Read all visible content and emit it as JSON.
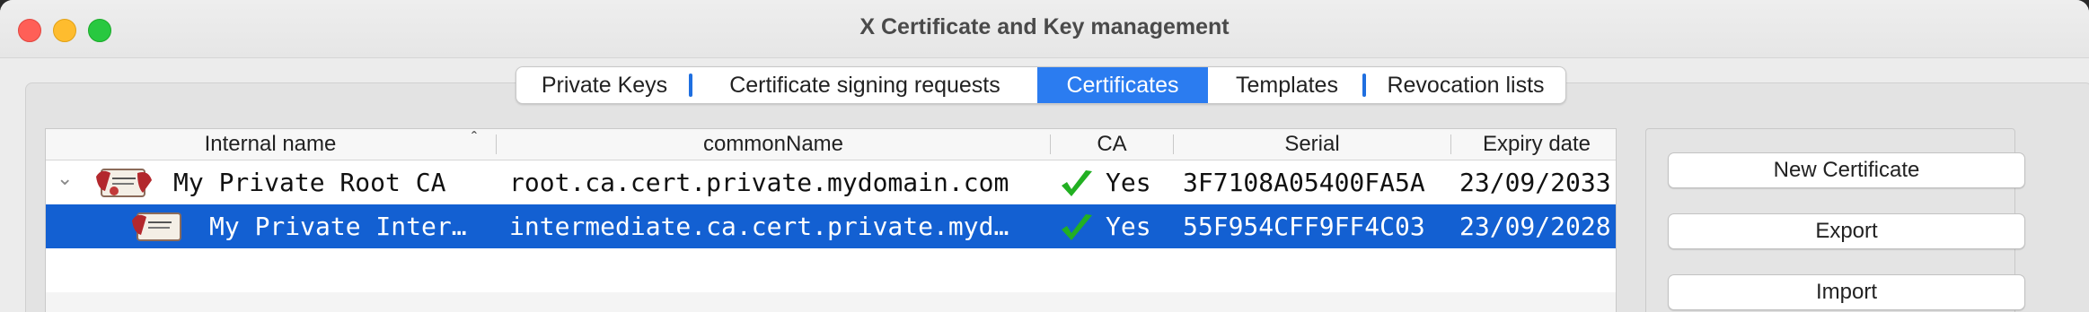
{
  "window": {
    "title": "X Certificate and Key management"
  },
  "tabs": [
    {
      "label": "Private Keys",
      "active": false
    },
    {
      "label": "Certificate signing requests",
      "active": false
    },
    {
      "label": "Certificates",
      "active": true
    },
    {
      "label": "Templates",
      "active": false
    },
    {
      "label": "Revocation lists",
      "active": false
    }
  ],
  "table": {
    "columns": [
      "Internal name",
      "commonName",
      "CA",
      "Serial",
      "Expiry date"
    ],
    "sort_indicator": "ˆ",
    "rows": [
      {
        "expander": "⌄",
        "internal_name": "My Private Root CA",
        "common_name": "root.ca.cert.private.mydomain.com",
        "ca": "Yes",
        "serial": "3F7108A05400FA5A",
        "expiry": "23/09/2033",
        "selected": false
      },
      {
        "expander": "",
        "internal_name": "My Private Inter…",
        "common_name": "intermediate.ca.cert.private.myd…",
        "ca": "Yes",
        "serial": "55F954CFF9FF4C03",
        "expiry": "23/09/2028",
        "selected": true
      }
    ]
  },
  "side_buttons": {
    "new_certificate": "New Certificate",
    "export": "Export",
    "import": "Import"
  },
  "colors": {
    "accent": "#2b7cf0",
    "selection": "#1360d2",
    "check": "#22b022"
  }
}
